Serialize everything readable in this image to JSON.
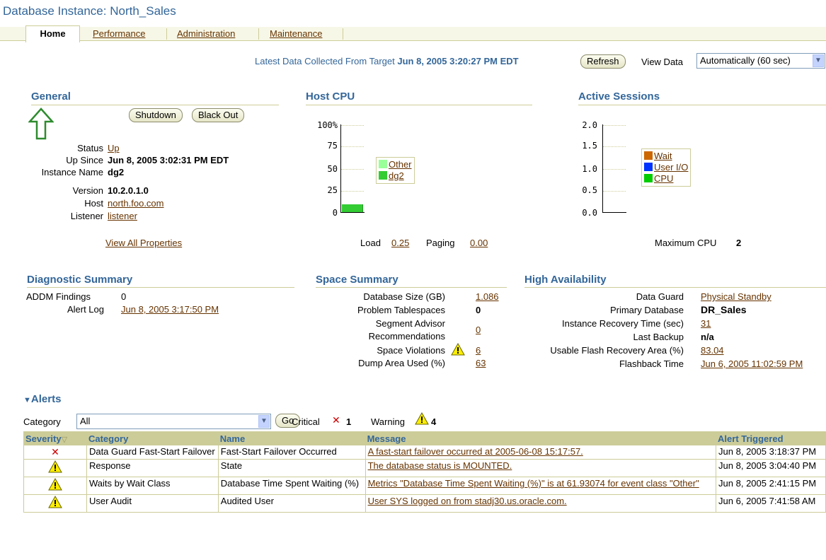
{
  "page": {
    "title": "Database Instance: North_Sales"
  },
  "tabs": [
    {
      "label": "Home",
      "active": true
    },
    {
      "label": "Performance",
      "active": false
    },
    {
      "label": "Administration",
      "active": false
    },
    {
      "label": "Maintenance",
      "active": false
    }
  ],
  "collection": {
    "prefix": "Latest Data Collected From Target",
    "timestamp": "Jun 8, 2005 3:20:27 PM EDT",
    "refresh_label": "Refresh",
    "view_data_label": "View Data",
    "view_data_value": "Automatically (60 sec)"
  },
  "general": {
    "heading": "General",
    "shutdown_label": "Shutdown",
    "blackout_label": "Black Out",
    "rows": [
      {
        "label": "Status",
        "value": "Up",
        "link": true
      },
      {
        "label": "Up Since",
        "value": "Jun 8, 2005 3:02:31 PM EDT",
        "link": false
      },
      {
        "label": "Instance Name",
        "value": "dg2",
        "link": false
      },
      {
        "label": "Version",
        "value": "10.2.0.1.0",
        "link": false
      },
      {
        "label": "Host",
        "value": "north.foo.com",
        "link": true
      },
      {
        "label": "Listener",
        "value": "listener",
        "link": true
      }
    ],
    "view_all_label": "View All Properties"
  },
  "host_cpu": {
    "heading": "Host CPU",
    "load_label": "Load",
    "load_value": "0.25",
    "paging_label": "Paging",
    "paging_value": "0.00"
  },
  "active_sessions": {
    "heading": "Active Sessions",
    "max_cpu_label": "Maximum CPU",
    "max_cpu_value": "2"
  },
  "chart_data": [
    {
      "type": "bar",
      "ylim": [
        0,
        100
      ],
      "yticks": [
        "100%",
        "75",
        "50",
        "25",
        "0"
      ],
      "series": [
        {
          "name": "Other",
          "values": [
            0
          ],
          "color": "#99ff99"
        },
        {
          "name": "dg2",
          "values": [
            9
          ],
          "color": "#33cc33"
        }
      ]
    },
    {
      "type": "area",
      "ylim": [
        0,
        2
      ],
      "yticks": [
        "2.0",
        "1.5",
        "1.0",
        "0.5",
        "0.0"
      ],
      "series": [
        {
          "name": "Wait",
          "values": [
            0
          ],
          "color": "#cc6600"
        },
        {
          "name": "User I/O",
          "values": [
            0
          ],
          "color": "#0033ff"
        },
        {
          "name": "CPU",
          "values": [
            0
          ],
          "color": "#00cc00"
        }
      ]
    }
  ],
  "diagnostic": {
    "heading": "Diagnostic Summary",
    "addm_label": "ADDM Findings",
    "addm_value": "0",
    "alert_log_label": "Alert Log",
    "alert_log_value": "Jun 8, 2005 3:17:50 PM"
  },
  "space": {
    "heading": "Space Summary",
    "db_size_label": "Database Size (GB)",
    "db_size_value": "1.086",
    "problem_ts_label": "Problem Tablespaces",
    "problem_ts_value": "0",
    "seg_adv_label_1": "Segment Advisor",
    "seg_adv_label_2": "Recommendations",
    "seg_adv_value": "0",
    "space_viol_label": "Space Violations",
    "space_viol_value": "6",
    "dump_label": "Dump Area Used (%)",
    "dump_value": "63"
  },
  "ha": {
    "heading": "High Availability",
    "data_guard_label": "Data Guard",
    "data_guard_value": "Physical Standby",
    "primary_label": "Primary Database",
    "primary_value": "DR_Sales",
    "recovery_label": "Instance Recovery Time (sec)",
    "recovery_value": "31",
    "backup_label": "Last Backup",
    "backup_value": "n/a",
    "flash_label": "Usable Flash Recovery Area (%)",
    "flash_value": "83.04",
    "flashback_label": "Flashback Time",
    "flashback_value": "Jun 6, 2005 11:02:59 PM"
  },
  "alerts": {
    "heading": "Alerts",
    "category_label": "Category",
    "category_value": "All",
    "go_label": "Go",
    "critical_label": "Critical",
    "critical_count": "1",
    "warning_label": "Warning",
    "warning_count": "4",
    "columns": [
      "Severity",
      "Category",
      "Name",
      "Message",
      "Alert Triggered"
    ],
    "rows": [
      {
        "severity": "critical",
        "category": "Data Guard Fast-Start Failover",
        "name": "Fast-Start Failover Occurred",
        "message": "A fast-start failover occurred at 2005-06-08 15:17:57.",
        "triggered": "Jun 8, 2005 3:18:37 PM"
      },
      {
        "severity": "warning",
        "category": "Response",
        "name": "State",
        "message": "The database status is MOUNTED.",
        "triggered": "Jun 8, 2005 3:04:40 PM"
      },
      {
        "severity": "warning",
        "category": "Waits by Wait Class",
        "name": "Database Time Spent Waiting (%)",
        "message": "Metrics \"Database Time Spent Waiting (%)\" is at 61.93074 for event class \"Other\"",
        "triggered": "Jun 8, 2005 2:41:15 PM"
      },
      {
        "severity": "warning",
        "category": "User Audit",
        "name": "Audited User",
        "message": "User SYS logged on from stadj30.us.oracle.com.",
        "triggered": "Jun 6, 2005 7:41:58 AM"
      }
    ]
  }
}
